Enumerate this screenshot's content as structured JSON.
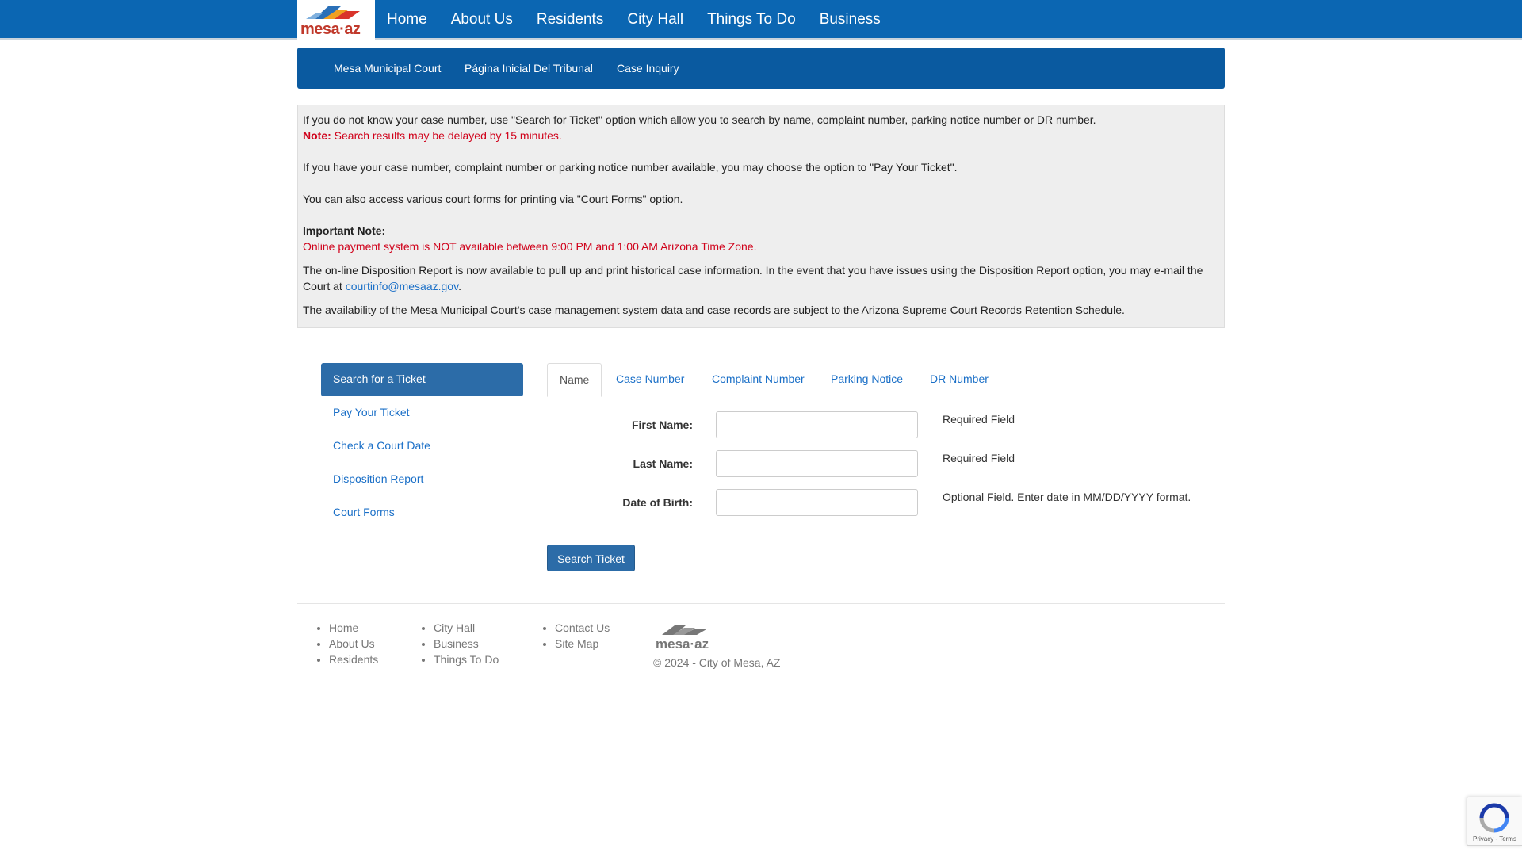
{
  "brand": {
    "logo_text": "mesa·az"
  },
  "topnav": [
    "Home",
    "About Us",
    "Residents",
    "City Hall",
    "Things To Do",
    "Business"
  ],
  "subnav": [
    "Mesa Municipal Court",
    "Página Inicial Del Tribunal",
    "Case Inquiry"
  ],
  "notice": {
    "p1": "If you do not know your case number, use \"Search for Ticket\" option which allow you to search by name, complaint number, parking notice number or DR number.",
    "note_label": "Note:",
    "note_text": " Search results may be delayed by 15 minutes.",
    "p2": "If you have your case number, complaint number or parking notice number available, you may choose the option to \"Pay Your Ticket\".",
    "p3": "You can also access various court forms for printing via \"Court Forms\" option.",
    "important_label": "Important Note:",
    "important_text": "Online payment system is NOT available between 9:00 PM and 1:00 AM Arizona Time Zone.",
    "p4_a": "The on-line Disposition Report is now available to pull up and print historical case information. In the event that you have issues using the Disposition Report option, you may e-mail the Court at ",
    "email": "courtinfo@mesaaz.gov",
    "p4_b": ".",
    "p5": "The availability of the Mesa Municipal Court's case management system data and case records are subject to the Arizona Supreme Court Records Retention Schedule."
  },
  "sidebar": [
    "Search for a Ticket",
    "Pay Your Ticket",
    "Check a Court Date",
    "Disposition Report",
    "Court Forms"
  ],
  "tabs": [
    "Name",
    "Case Number",
    "Complaint Number",
    "Parking Notice",
    "DR Number"
  ],
  "form": {
    "first_name_label": "First Name:",
    "last_name_label": "Last Name:",
    "dob_label": "Date of Birth:",
    "first_name_hint": "Required Field",
    "last_name_hint": "Required Field",
    "dob_hint": "Optional Field. Enter date in MM/DD/YYYY format.",
    "first_name_value": "",
    "last_name_value": "",
    "dob_value": "",
    "submit": "Search Ticket"
  },
  "footer": {
    "col1": [
      "Home",
      "About Us",
      "Residents"
    ],
    "col2": [
      "City Hall",
      "Business",
      "Things To Do"
    ],
    "col3": [
      "Contact Us",
      "Site Map"
    ],
    "logo_text": "mesa·az",
    "copyright": "© 2024 - City of Mesa, AZ"
  },
  "recaptcha": {
    "terms": "Privacy - Terms"
  },
  "colors": {
    "nav_blue": "#0b66b2",
    "subnav_blue": "#0a5aa0",
    "link_blue": "#1a6fc7",
    "alert_red": "#d0021b"
  }
}
